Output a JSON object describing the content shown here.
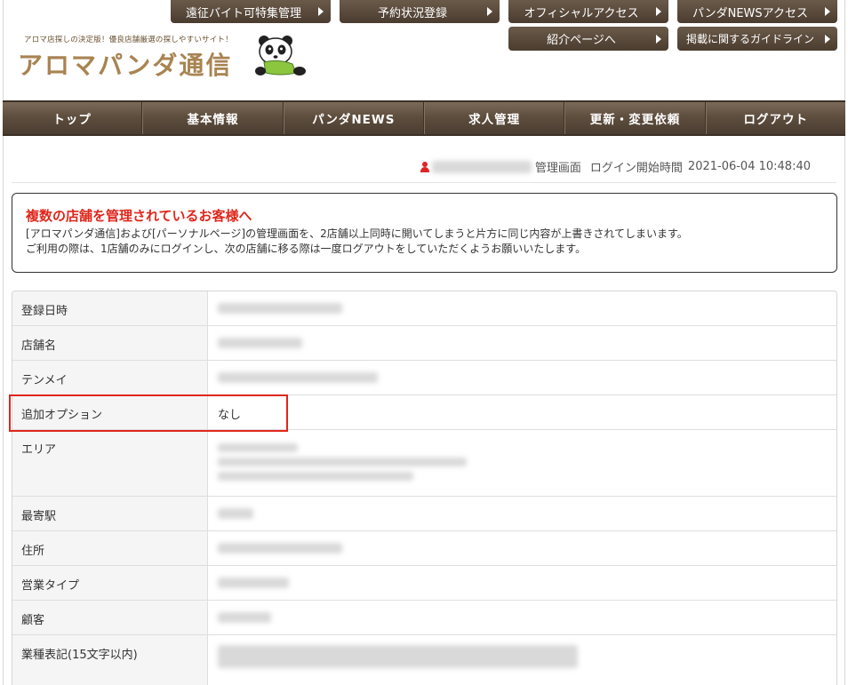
{
  "top_buttons": {
    "row1": [
      "遠征バイト可特集管理",
      "予約状況登録",
      "オフィシャルアクセス",
      "パンダNEWSアクセス"
    ],
    "row2": [
      "紹介ページへ",
      "掲載に関するガイドライン"
    ]
  },
  "logo": {
    "tagline": "アロマ店探しの決定版！優良店舗厳選の探しやすいサイト！",
    "title": "アロマパンダ通信"
  },
  "nav": [
    "トップ",
    "基本情報",
    "パンダNEWS",
    "求人管理",
    "更新・変更依頼",
    "ログアウト"
  ],
  "login": {
    "admin_label": "管理画面",
    "login_label": "ログイン開始時間",
    "login_time": "2021-06-04 10:48:40"
  },
  "notice": {
    "title": "複数の店舗を管理されているお客様へ",
    "line1": "[アロマパンダ通信]および[パーソナルページ]の管理画面を、2店舗以上同時に開いてしまうと片方に同じ内容が上書きされてしまいます。",
    "line2": "ご利用の際は、1店舗のみにログインし、次の店舗に移る際は一度ログアウトをしていただくようお願いいたします。"
  },
  "table": [
    {
      "label": "登録日時",
      "value": ""
    },
    {
      "label": "店舗名",
      "value": ""
    },
    {
      "label": "テンメイ",
      "value": ""
    },
    {
      "label": "追加オプション",
      "value": "なし"
    },
    {
      "label": "エリア",
      "value": ""
    },
    {
      "label": "最寄駅",
      "value": ""
    },
    {
      "label": "住所",
      "value": ""
    },
    {
      "label": "営業タイプ",
      "value": ""
    },
    {
      "label": "顧客",
      "value": ""
    },
    {
      "label": "業種表記(15文字以内)",
      "value": ""
    }
  ],
  "colors": {
    "nav_bg": "#5e4e3e",
    "button_bg": "#5a4a3b",
    "logo_color": "#a88452",
    "notice_title": "#e0261b",
    "highlight": "#e0261b"
  }
}
